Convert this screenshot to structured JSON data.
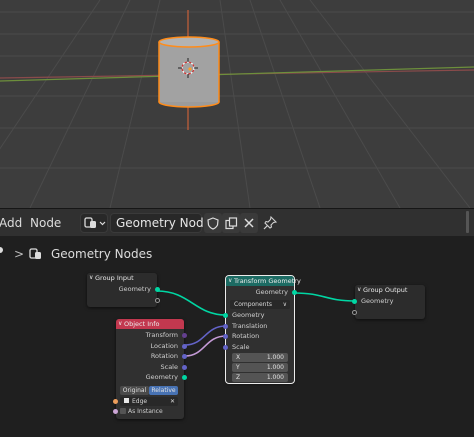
{
  "viewport": {
    "colors": {
      "background": "#3d3d3d",
      "grid": "#4a4a4a",
      "x_axis": "#8a4a4a",
      "y_axis": "#6b8a3a",
      "z_axis": "#c9603a",
      "object_outline": "#ff8c1a",
      "object_fill": "#9b9b9b"
    }
  },
  "header": {
    "menu_add": "Add",
    "menu_node": "Node",
    "editor_type_icon": "node-editor-icon",
    "tree_name": "Geometry Nodes",
    "fake_user_icon": "shield-icon",
    "duplicate_icon": "copy-icon",
    "unlink_icon": "close-icon",
    "pin_icon": "pin-icon"
  },
  "breadcrumb": {
    "separator": ">",
    "label": "Geometry Nodes"
  },
  "nodes": {
    "group_input": {
      "title": "Group Input",
      "outputs": [
        "Geometry"
      ]
    },
    "object_info": {
      "title": "Object Info",
      "header_color": "#c2384f",
      "outputs": [
        "Transform",
        "Location",
        "Rotation",
        "Scale",
        "Geometry"
      ],
      "mode_options": [
        "Original",
        "Relative"
      ],
      "mode_selected": "Relative",
      "object_value": "Edge",
      "as_instance_label": "As Instance"
    },
    "transform_geometry": {
      "title": "Transform Geometry",
      "header_color": "#1c6b63",
      "output": "Geometry",
      "mode": "Components",
      "inputs": [
        "Geometry",
        "Translation",
        "Rotation",
        "Scale"
      ],
      "scale_fields": [
        {
          "axis": "X",
          "value": "1.000"
        },
        {
          "axis": "Y",
          "value": "1.000"
        },
        {
          "axis": "Z",
          "value": "1.000"
        }
      ]
    },
    "group_output": {
      "title": "Group Output",
      "inputs": [
        "Geometry"
      ]
    }
  }
}
